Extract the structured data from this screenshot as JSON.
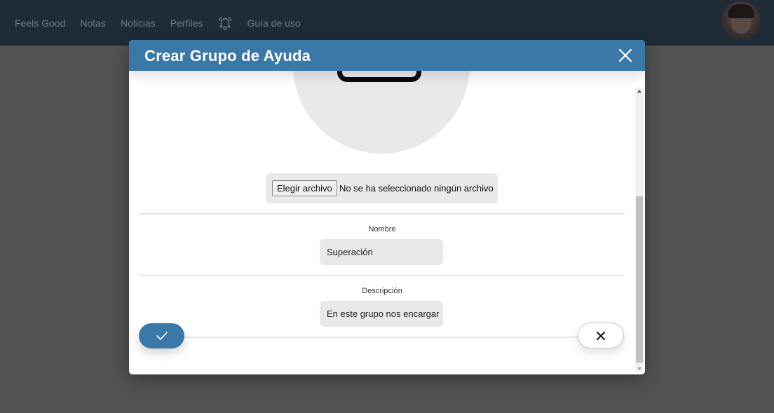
{
  "navbar": {
    "links": [
      "Feels Good",
      "Notas",
      "Noticias",
      "Perfiles",
      "Guía de uso"
    ]
  },
  "modal": {
    "title": "Crear Grupo de Ayuda",
    "file_button": "Elegir archivo",
    "file_status": "No se ha seleccionado ningún archivo",
    "name_label": "Nombre",
    "name_value": "Superación",
    "description_label": "Descripción",
    "description_value": "En este grupo nos encargar"
  },
  "icons": {
    "bell": "bell-icon",
    "close": "close-icon",
    "confirm": "checkmark-icon",
    "cancel": "x-icon"
  },
  "colors": {
    "primary": "#3a78a8",
    "navbar": "#1f2c38"
  }
}
